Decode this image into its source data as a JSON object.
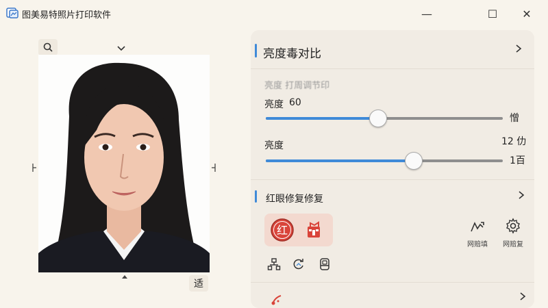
{
  "window": {
    "title": "图美易特照片打印软件",
    "minimize_glyph": "—",
    "maximize_glyph": "☐",
    "close_glyph": "✕"
  },
  "preview": {
    "confirm_label": "适"
  },
  "panel": {
    "brightness_section": {
      "title": "亮度毒对比",
      "blurred_label": "亮度 打周调节印",
      "slider1": {
        "label": "亮度",
        "value_text": "60",
        "value": 0.47,
        "end_label": "憎"
      },
      "slider2": {
        "label": "亮度",
        "top_right": "12 仂",
        "value": 0.62,
        "end_label": "1百"
      }
    },
    "redeye_section": {
      "title": "红眼修复修复",
      "tool_red_glyph": "红",
      "side_tools": [
        {
          "label": "网赔填",
          "icon": "wave-arrow-icon"
        },
        {
          "label": "网赔复",
          "icon": "gear-icon"
        }
      ]
    }
  },
  "colors": {
    "accent": "#3f8ad8",
    "red": "#d9443a"
  }
}
